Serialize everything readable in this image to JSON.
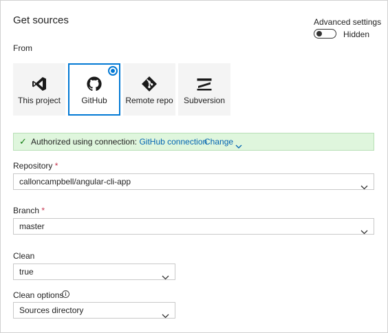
{
  "header": {
    "title": "Get sources",
    "advanced_label": "Advanced settings",
    "toggle_state": "Hidden"
  },
  "source_picker": {
    "label": "From",
    "selected": "GitHub",
    "options": [
      {
        "label": "This project",
        "icon": "visual-studio-icon"
      },
      {
        "label": "GitHub",
        "icon": "github-icon"
      },
      {
        "label": "Remote repo",
        "icon": "git-icon"
      },
      {
        "label": "Subversion",
        "icon": "subversion-icon"
      }
    ]
  },
  "auth_banner": {
    "message": "Authorized using connection:",
    "connection": "GitHub connection",
    "change_label": "Change"
  },
  "repository": {
    "label": "Repository",
    "required_mark": "*",
    "value": "calloncampbell/angular-cli-app"
  },
  "branch": {
    "label": "Branch",
    "required_mark": "*",
    "value": "master"
  },
  "clean": {
    "label": "Clean",
    "value": "true"
  },
  "clean_options": {
    "label": "Clean options",
    "value": "Sources directory"
  },
  "colors": {
    "accent": "#0078d4",
    "success_bg": "#dff6dd",
    "success_icon": "#107c10",
    "required": "#c4314b"
  }
}
